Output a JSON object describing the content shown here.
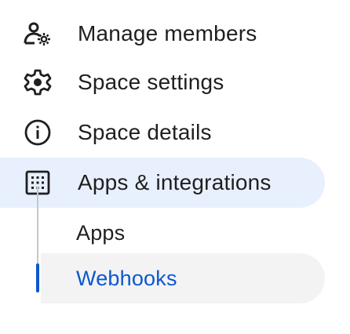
{
  "menu": {
    "items": [
      {
        "label": "Manage members",
        "icon": "manage-members-icon"
      },
      {
        "label": "Space settings",
        "icon": "settings-gear-icon"
      },
      {
        "label": "Space details",
        "icon": "info-icon"
      },
      {
        "label": "Apps & integrations",
        "icon": "apps-integrations-icon"
      }
    ],
    "subitems": [
      {
        "label": "Apps"
      },
      {
        "label": "Webhooks"
      }
    ]
  },
  "colors": {
    "highlight_bg": "#e8f0fe",
    "selected_bg": "#f3f3f3",
    "accent": "#0b57d0",
    "text": "#1f1f1f"
  }
}
